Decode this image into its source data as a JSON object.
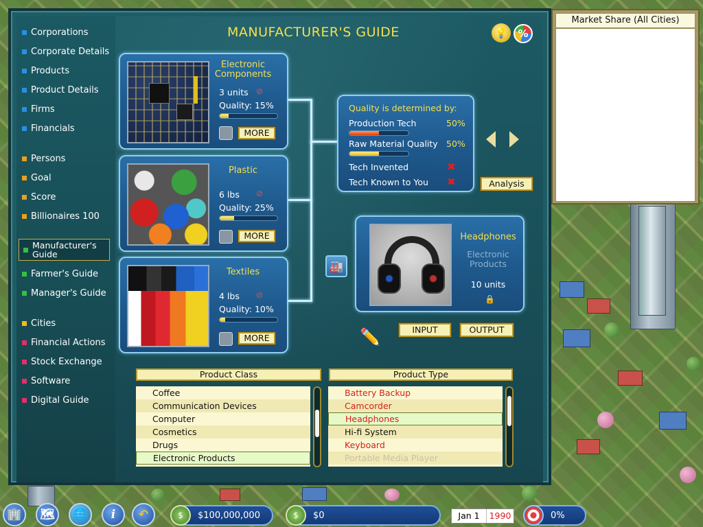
{
  "sidebar": {
    "items": [
      {
        "label": "Corporations",
        "color": "#2a8fe0"
      },
      {
        "label": "Corporate Details",
        "color": "#2a8fe0"
      },
      {
        "label": "Products",
        "color": "#2a8fe0"
      },
      {
        "label": "Product Details",
        "color": "#2a8fe0"
      },
      {
        "label": "Firms",
        "color": "#2a8fe0"
      },
      {
        "label": "Financials",
        "color": "#2a8fe0"
      },
      {
        "label": "Persons",
        "color": "#e8a020"
      },
      {
        "label": "Goal",
        "color": "#e8a020"
      },
      {
        "label": "Score",
        "color": "#e8a020"
      },
      {
        "label": "Billionaires 100",
        "color": "#e8a020"
      },
      {
        "label": "Manufacturer's Guide",
        "color": "#34c040"
      },
      {
        "label": "Farmer's Guide",
        "color": "#34c040"
      },
      {
        "label": "Manager's Guide",
        "color": "#34c040"
      },
      {
        "label": "Cities",
        "color": "#e8c020"
      },
      {
        "label": "Financial Actions",
        "color": "#e0306a"
      },
      {
        "label": "Stock Exchange",
        "color": "#e0306a"
      },
      {
        "label": "Software",
        "color": "#e0306a"
      },
      {
        "label": "Digital Guide",
        "color": "#e0306a"
      }
    ]
  },
  "header": {
    "title": "MANUFACTURER'S GUIDE",
    "percent_icon": "%"
  },
  "materials": [
    {
      "name": "Electronic Components",
      "amount": "3 units",
      "quality": "Quality: 15%",
      "quality_level": 0.15,
      "more": "MORE"
    },
    {
      "name": "Plastic",
      "amount": "6 lbs",
      "quality": "Quality: 25%",
      "quality_level": 0.25,
      "more": "MORE"
    },
    {
      "name": "Textiles",
      "amount": "4 lbs",
      "quality": "Quality: 10%",
      "quality_level": 0.1,
      "more": "MORE"
    }
  ],
  "quality_panel": {
    "title": "Quality is determined by:",
    "production_tech": {
      "label": "Production Tech",
      "value": "50%",
      "level": 0.5
    },
    "raw_material": {
      "label": "Raw Material Quality",
      "value": "50%",
      "level": 0.5
    },
    "tech_invented": "Tech Invented",
    "tech_known": "Tech Known to You",
    "analysis_button": "Analysis"
  },
  "product": {
    "name": "Headphones",
    "category": "Electronic Products",
    "units": "10 units",
    "input_button": "INPUT",
    "output_button": "OUTPUT"
  },
  "product_class": {
    "header": "Product Class",
    "items": [
      "Coffee",
      "Communication Devices",
      "Computer",
      "Cosmetics",
      "Drugs",
      "Electronic Products"
    ],
    "selected": "Electronic Products"
  },
  "product_type": {
    "header": "Product Type",
    "items": [
      "Battery Backup",
      "Camcorder",
      "Headphones",
      "Hi-fi System",
      "Keyboard",
      "Portable Media Player"
    ],
    "selected": "Headphones"
  },
  "market_share": {
    "title": "Market Share (All Cities)"
  },
  "status_bar": {
    "cash": "$100,000,000",
    "profit": "$0",
    "date": "Jan 1",
    "year": "1990",
    "percent": "0%"
  }
}
